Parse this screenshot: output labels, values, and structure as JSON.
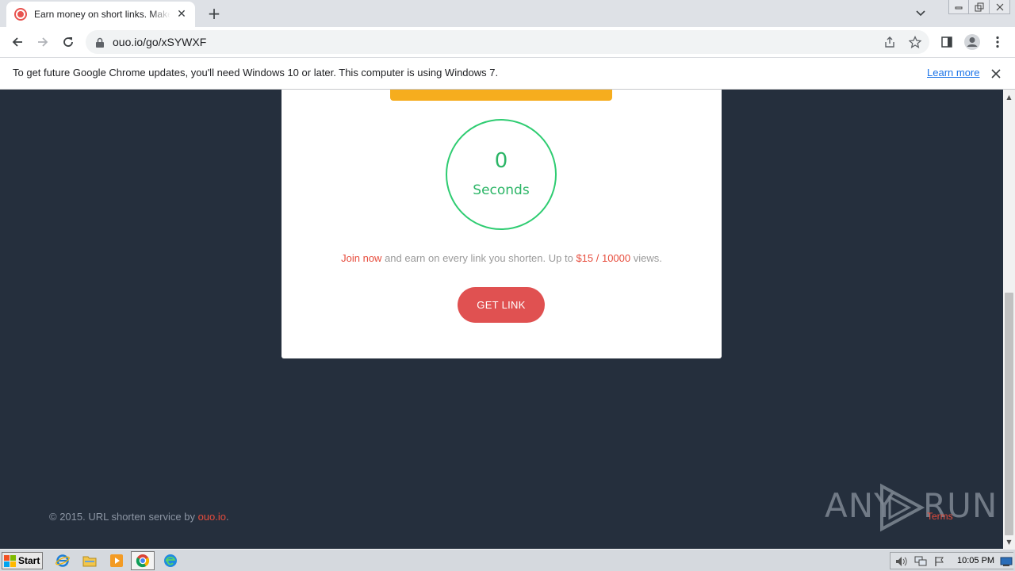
{
  "browser": {
    "tab_title": "Earn money on short links. Make short links and earn money",
    "url": "ouo.io/go/xSYWXF",
    "infobar_message": "To get future Google Chrome updates, you'll need Windows 10 or later. This computer is using Windows 7.",
    "infobar_link": "Learn more"
  },
  "page": {
    "timer_value": "0",
    "timer_unit": "Seconds",
    "promo": {
      "join": "Join now",
      "middle": " and earn on every link you shorten. Up to ",
      "rate": "$15 / 10000",
      "end": " views."
    },
    "get_link_label": "GET LINK",
    "footer": {
      "prefix": "© 2015. URL shorten service by ",
      "brand": "ouo.io",
      "suffix": ".",
      "terms": "Terms"
    }
  },
  "watermark": {
    "left": "ANY",
    "right": "RUN"
  },
  "taskbar": {
    "start_label": "Start",
    "clock": "10:05 PM"
  },
  "colors": {
    "page_bg": "#252f3d",
    "accent_red": "#e05151",
    "timer_green": "#2ecc71",
    "orange": "#f6ad1e"
  }
}
